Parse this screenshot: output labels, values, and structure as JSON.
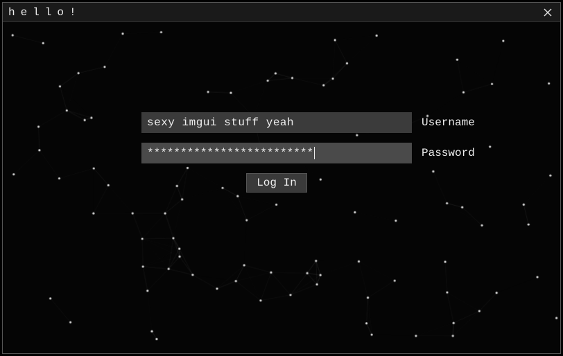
{
  "window": {
    "title": "hello!"
  },
  "form": {
    "username_value": "sexy imgui stuff yeah",
    "username_label": "Username",
    "password_masked": "*************************",
    "password_label": "Password",
    "login_label": "Log In"
  },
  "colors": {
    "background": "#050505",
    "titlebar": "#1a1a1a",
    "input_bg": "#3b3b3b",
    "input_active_bg": "#4a4a4a",
    "text": "#e8e8e8",
    "particle": "#cccccc"
  }
}
